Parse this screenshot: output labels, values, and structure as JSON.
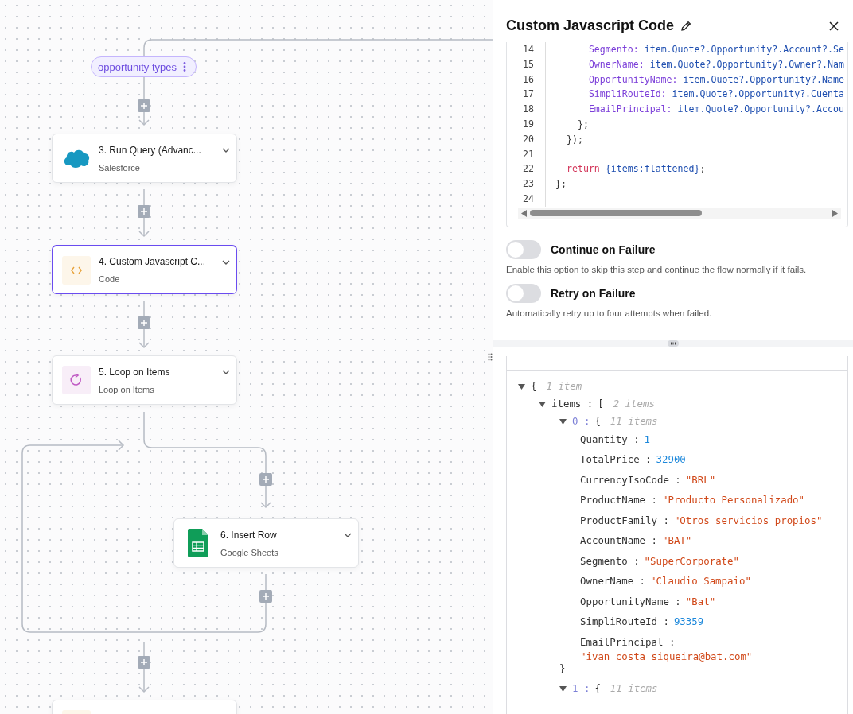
{
  "canvas": {
    "branch_label": {
      "text": "opportunity types"
    },
    "steps": [
      {
        "title": "3. Run Query (Advanc...",
        "subtitle": "Salesforce",
        "kind": "salesforce",
        "selected": false
      },
      {
        "title": "4. Custom Javascript C...",
        "subtitle": "Code",
        "kind": "code",
        "selected": true
      },
      {
        "title": "5. Loop on Items",
        "subtitle": "Loop on Items",
        "kind": "loop",
        "selected": false
      },
      {
        "title": "6. Insert Row",
        "subtitle": "Google Sheets",
        "kind": "sheets",
        "selected": false
      },
      {
        "kind": "code",
        "selected": false
      }
    ]
  },
  "panel": {
    "title": "Custom Javascript Code",
    "code_lines": [
      {
        "number": "14",
        "tokens": [
          {
            "text": "      Segmento: ",
            "kind": "prop"
          },
          {
            "text": "item.Quote?.Opportunity?.Account?.Se",
            "kind": "ref"
          }
        ]
      },
      {
        "number": "15",
        "tokens": [
          {
            "text": "      OwnerName: ",
            "kind": "prop"
          },
          {
            "text": "item.Quote?.Opportunity?.Owner?.Nam",
            "kind": "ref"
          }
        ]
      },
      {
        "number": "16",
        "tokens": [
          {
            "text": "      OpportunityName: ",
            "kind": "prop"
          },
          {
            "text": "item.Quote?.Opportunity?.Name",
            "kind": "ref"
          }
        ]
      },
      {
        "number": "17",
        "tokens": [
          {
            "text": "      SimpliRouteId: ",
            "kind": "prop"
          },
          {
            "text": "item.Quote?.Opportunity?.Cuenta",
            "kind": "ref"
          }
        ]
      },
      {
        "number": "18",
        "tokens": [
          {
            "text": "      EmailPrincipal: ",
            "kind": "prop"
          },
          {
            "text": "item.Quote?.Opportunity?.Accou",
            "kind": "ref"
          }
        ]
      },
      {
        "number": "19",
        "tokens": [
          {
            "text": "    };",
            "kind": "plain"
          }
        ]
      },
      {
        "number": "20",
        "tokens": [
          {
            "text": "  });",
            "kind": "plain"
          }
        ]
      },
      {
        "number": "21"
      },
      {
        "number": "22",
        "tokens": [
          {
            "text": "  return ",
            "kind": "keyword"
          },
          {
            "text": "{items:flattened}",
            "kind": "ref"
          },
          {
            "text": ";",
            "kind": "plain"
          }
        ]
      },
      {
        "number": "23",
        "tokens": [
          {
            "text": "};",
            "kind": "plain"
          }
        ]
      },
      {
        "number": "24"
      }
    ],
    "options": [
      {
        "label": "Continue on Failure",
        "description": "Enable this option to skip this step and continue the flow normally if it fails.",
        "on": false
      },
      {
        "label": "Retry on Failure",
        "description": "Automatically retry up to four attempts when failed.",
        "on": false
      }
    ],
    "json_viewer": {
      "root": {
        "open": "{",
        "summary": "1 item",
        "expanded": true,
        "children": [
          {
            "key": "items :",
            "open": "[",
            "summary": "2 items",
            "expanded": true,
            "children": [
              {
                "key": "0 :",
                "kind": "index",
                "open": "{",
                "summary": "11 items",
                "expanded": true,
                "close": "}",
                "children": [
                  {
                    "key": "Quantity :",
                    "value": "1",
                    "kind": "number"
                  },
                  {
                    "key": "TotalPrice :",
                    "value": "32900",
                    "kind": "number"
                  },
                  {
                    "key": "CurrencyIsoCode :",
                    "value": "\"BRL\"",
                    "kind": "string"
                  },
                  {
                    "key": "ProductName :",
                    "value": "\"Producto Personalizado\"",
                    "kind": "string"
                  },
                  {
                    "key": "ProductFamily :",
                    "value": "\"Otros servicios propios\"",
                    "kind": "string"
                  },
                  {
                    "key": "AccountName :",
                    "value": "\"BAT\"",
                    "kind": "string"
                  },
                  {
                    "key": "Segmento :",
                    "value": "\"SuperCorporate\"",
                    "kind": "string"
                  },
                  {
                    "key": "OwnerName :",
                    "value": "\"Claudio Sampaio\"",
                    "kind": "string"
                  },
                  {
                    "key": "OpportunityName :",
                    "value": "\"Bat\"",
                    "kind": "string"
                  },
                  {
                    "key": "SimpliRouteId :",
                    "value": "93359",
                    "kind": "number"
                  },
                  {
                    "key": "EmailPrincipal :",
                    "value": "\"ivan_costa_siqueira@bat.com\"",
                    "kind": "string"
                  }
                ]
              },
              {
                "key": "1 :",
                "kind": "index",
                "open": "{",
                "summary": "11 items",
                "expanded": true
              }
            ]
          }
        ]
      }
    }
  }
}
